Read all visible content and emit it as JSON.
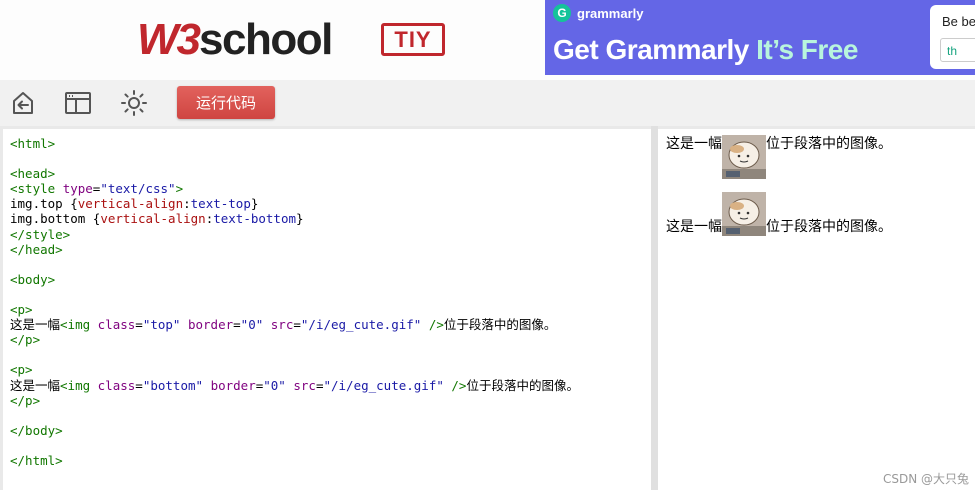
{
  "header": {
    "logo_w3": "W3",
    "logo_school": "school",
    "tiy_badge": "TIY"
  },
  "ad": {
    "brand": "grammarly",
    "brand_icon": "G",
    "headline_main": "Get Grammarly ",
    "headline_accent": "It’s Free",
    "card_text": "Be be",
    "card_box_text": "th",
    "colors": {
      "background": "#6466e6",
      "accent": "#b8f5dd",
      "brand_green": "#15c39a"
    }
  },
  "toolbar": {
    "icons": [
      "back-icon",
      "layout-icon",
      "theme-brightness-icon"
    ],
    "run_label": "运行代码",
    "run_color": "#d9534f"
  },
  "code": {
    "lines": [
      [
        {
          "t": "tag",
          "v": "<html>"
        }
      ],
      [],
      [
        {
          "t": "tag",
          "v": "<head>"
        }
      ],
      [
        {
          "t": "tag",
          "v": "<style "
        },
        {
          "t": "attr",
          "v": "type"
        },
        {
          "t": "sel",
          "v": "="
        },
        {
          "t": "str",
          "v": "\"text/css\""
        },
        {
          "t": "tag",
          "v": ">"
        }
      ],
      [
        {
          "t": "sel",
          "v": "img.top "
        },
        {
          "t": "sel",
          "v": "{"
        },
        {
          "t": "prop",
          "v": "vertical-align"
        },
        {
          "t": "sel",
          "v": ":"
        },
        {
          "t": "str",
          "v": "text-top"
        },
        {
          "t": "sel",
          "v": "}"
        }
      ],
      [
        {
          "t": "sel",
          "v": "img.bottom "
        },
        {
          "t": "sel",
          "v": "{"
        },
        {
          "t": "prop",
          "v": "vertical-align"
        },
        {
          "t": "sel",
          "v": ":"
        },
        {
          "t": "str",
          "v": "text-bottom"
        },
        {
          "t": "sel",
          "v": "}"
        }
      ],
      [
        {
          "t": "tag",
          "v": "</style>"
        }
      ],
      [
        {
          "t": "tag",
          "v": "</head>"
        }
      ],
      [],
      [
        {
          "t": "tag",
          "v": "<body>"
        }
      ],
      [],
      [
        {
          "t": "tag",
          "v": "<p>"
        }
      ],
      [
        {
          "t": "txt",
          "v": "这是一幅"
        },
        {
          "t": "tag",
          "v": "<img "
        },
        {
          "t": "attr",
          "v": "class"
        },
        {
          "t": "sel",
          "v": "="
        },
        {
          "t": "str",
          "v": "\"top\" "
        },
        {
          "t": "attr",
          "v": "border"
        },
        {
          "t": "sel",
          "v": "="
        },
        {
          "t": "str",
          "v": "\"0\" "
        },
        {
          "t": "attr",
          "v": "src"
        },
        {
          "t": "sel",
          "v": "="
        },
        {
          "t": "str",
          "v": "\"/i/eg_cute.gif\" "
        },
        {
          "t": "tag",
          "v": "/>"
        },
        {
          "t": "txt",
          "v": "位于段落中的图像。"
        }
      ],
      [
        {
          "t": "tag",
          "v": "</p>"
        }
      ],
      [],
      [
        {
          "t": "tag",
          "v": "<p>"
        }
      ],
      [
        {
          "t": "txt",
          "v": "这是一幅"
        },
        {
          "t": "tag",
          "v": "<img "
        },
        {
          "t": "attr",
          "v": "class"
        },
        {
          "t": "sel",
          "v": "="
        },
        {
          "t": "str",
          "v": "\"bottom\" "
        },
        {
          "t": "attr",
          "v": "border"
        },
        {
          "t": "sel",
          "v": "="
        },
        {
          "t": "str",
          "v": "\"0\" "
        },
        {
          "t": "attr",
          "v": "src"
        },
        {
          "t": "sel",
          "v": "="
        },
        {
          "t": "str",
          "v": "\"/i/eg_cute.gif\" "
        },
        {
          "t": "tag",
          "v": "/>"
        },
        {
          "t": "txt",
          "v": "位于段落中的图像。"
        }
      ],
      [
        {
          "t": "tag",
          "v": "</p>"
        }
      ],
      [],
      [
        {
          "t": "tag",
          "v": "</body>"
        }
      ],
      [],
      [
        {
          "t": "tag",
          "v": "</html>"
        }
      ]
    ]
  },
  "result": {
    "para1_before": "这是一幅",
    "para1_after": "位于段落中的图像。",
    "para2_before": "这是一幅",
    "para2_after": "位于段落中的图像。",
    "watermark": "CSDN @大只兔"
  }
}
